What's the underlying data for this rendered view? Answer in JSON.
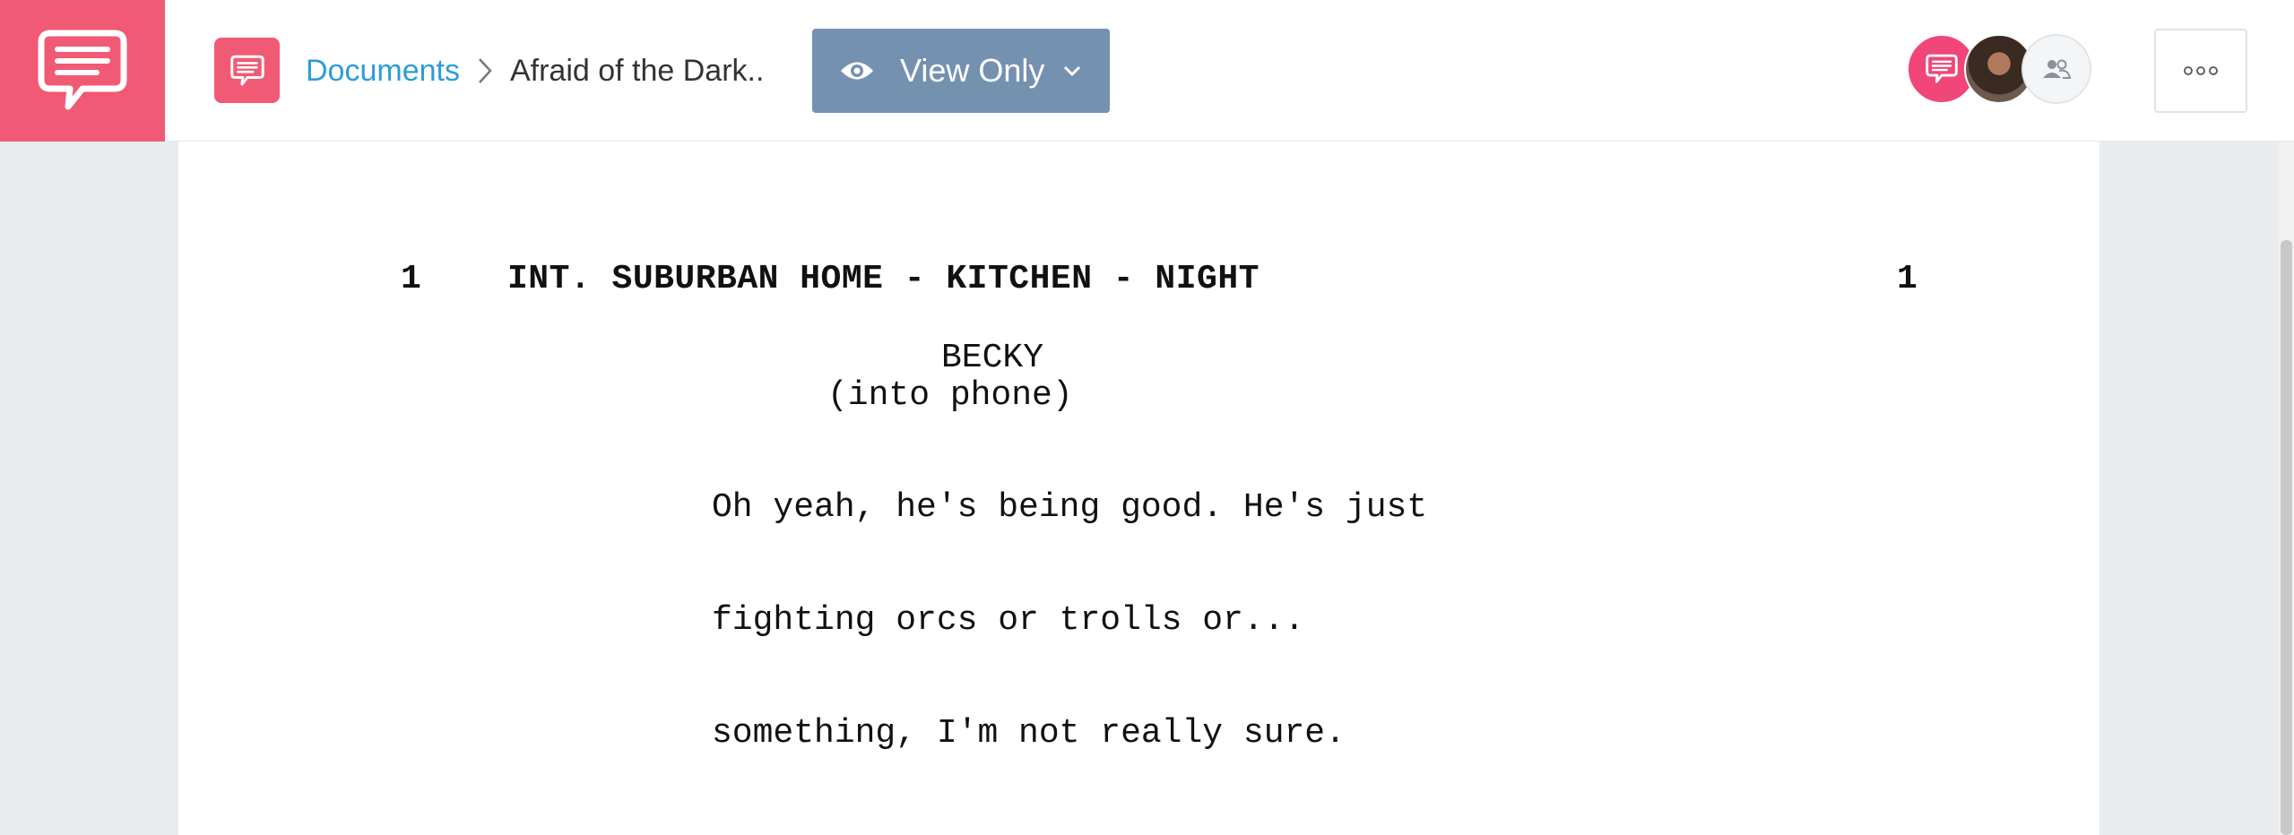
{
  "header": {
    "breadcrumb": {
      "root_label": "Documents",
      "current_label": "Afraid of the Dark.."
    },
    "view_mode_button": {
      "label": "View Only"
    },
    "collaborators": [
      {
        "icon": "app-logo-icon",
        "color": "#f0467a"
      },
      {
        "icon": "user-photo"
      },
      {
        "icon": "people-icon"
      }
    ],
    "more_button_icon": "more-dots-icon"
  },
  "colors": {
    "brand": "#f15a74",
    "link": "#2d9cd8",
    "view_button": "#7591b0"
  },
  "screenplay": {
    "scene_number_left": "1",
    "scene_heading": "INT. SUBURBAN HOME - KITCHEN - NIGHT",
    "scene_number_right": "1",
    "character": "BECKY",
    "parenthetical": "(into phone)",
    "dialogue_lines": [
      "Oh yeah, he's being good. He's just",
      "fighting orcs or trolls or...",
      "something, I'm not really sure."
    ]
  }
}
